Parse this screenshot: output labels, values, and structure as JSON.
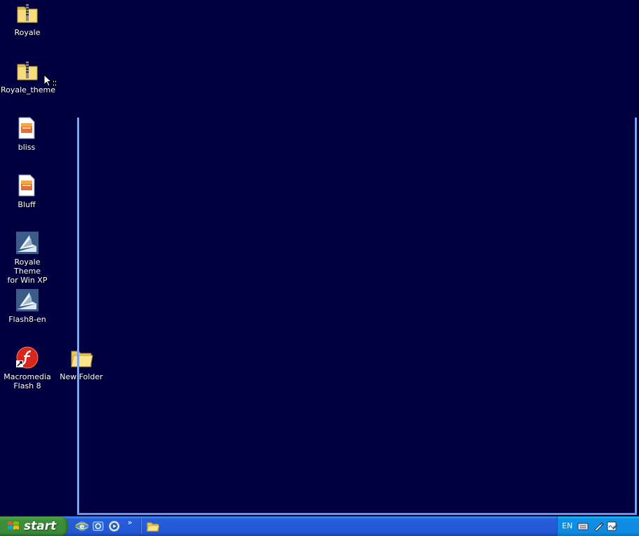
{
  "desktop": {
    "background_color": "#000040",
    "icons": [
      {
        "label": "Royale",
        "icon": "zip-folder-icon"
      },
      {
        "label": "Royale_theme",
        "icon": "zip-folder-icon"
      },
      {
        "label": "bliss",
        "icon": "image-file-icon"
      },
      {
        "label": "Bluff",
        "icon": "image-file-icon"
      },
      {
        "label": "Royale Theme\nfor Win XP",
        "icon": "installer-icon"
      },
      {
        "label": "Flash8-en",
        "icon": "installer-icon"
      },
      {
        "label": "Macromedia\nFlash 8",
        "icon": "flash-shortcut-icon"
      },
      {
        "label": "New Folder",
        "icon": "folder-icon"
      }
    ]
  },
  "taskbar": {
    "start_label": "start",
    "quick_launch_more": "»",
    "tray_language": "EN"
  }
}
